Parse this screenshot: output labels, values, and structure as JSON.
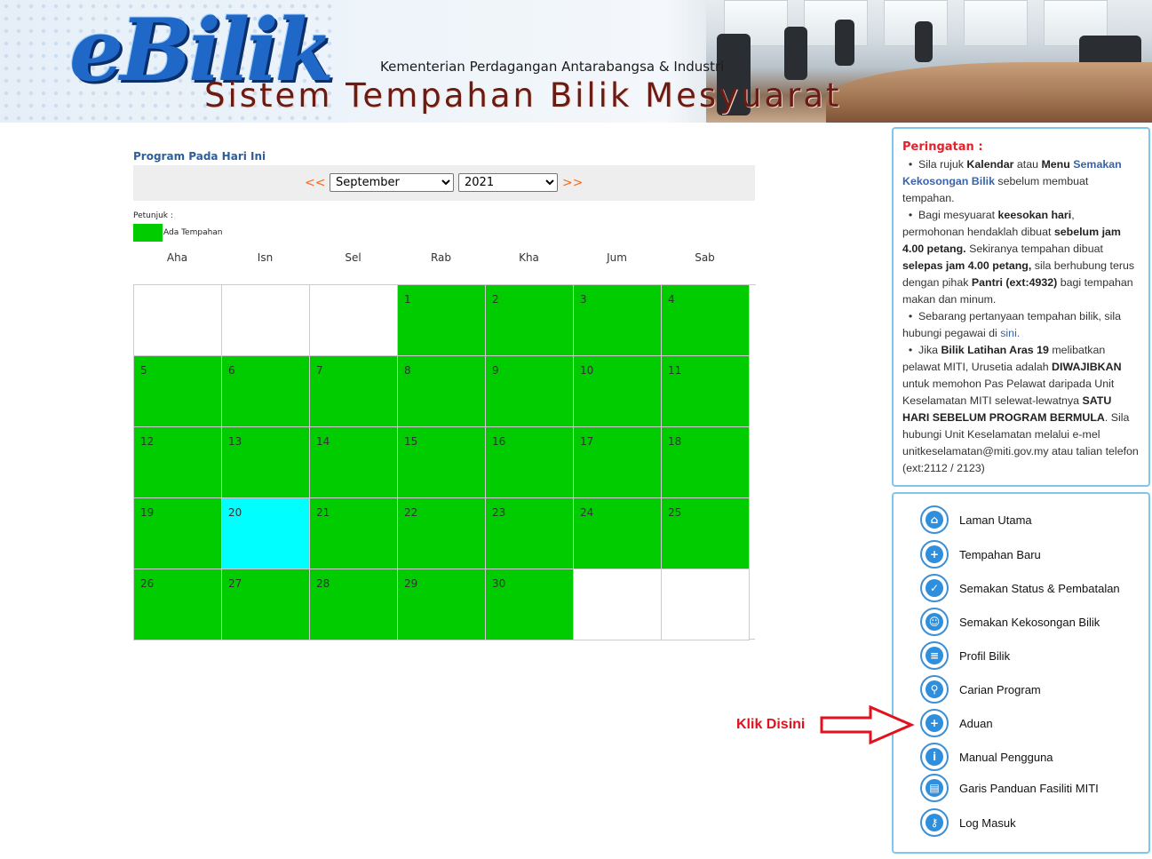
{
  "banner": {
    "logo": "eBilik",
    "ministry": "Kementerian Perdagangan Antarabangsa & Industri",
    "system": "Sistem Tempahan Bilik Mesyuarat"
  },
  "calendar": {
    "title": "Program Pada Hari Ini",
    "prev": "<<",
    "next": ">>",
    "month_selected": "September",
    "year_selected": "2021",
    "legend_title": "Petunjuk :",
    "legend_label": "Ada Tempahan",
    "booked_color": "#00cc00",
    "today_color": "#00ffff",
    "days": [
      "Aha",
      "Isn",
      "Sel",
      "Rab",
      "Kha",
      "Jum",
      "Sab"
    ],
    "weeks": [
      [
        {
          "d": "",
          "s": "empty"
        },
        {
          "d": "",
          "s": "empty"
        },
        {
          "d": "",
          "s": "empty"
        },
        {
          "d": "1",
          "s": "booked"
        },
        {
          "d": "2",
          "s": "booked"
        },
        {
          "d": "3",
          "s": "booked"
        },
        {
          "d": "4",
          "s": "booked"
        }
      ],
      [
        {
          "d": "5",
          "s": "booked"
        },
        {
          "d": "6",
          "s": "booked"
        },
        {
          "d": "7",
          "s": "booked"
        },
        {
          "d": "8",
          "s": "booked"
        },
        {
          "d": "9",
          "s": "booked"
        },
        {
          "d": "10",
          "s": "booked"
        },
        {
          "d": "11",
          "s": "booked"
        }
      ],
      [
        {
          "d": "12",
          "s": "booked"
        },
        {
          "d": "13",
          "s": "booked"
        },
        {
          "d": "14",
          "s": "booked"
        },
        {
          "d": "15",
          "s": "booked"
        },
        {
          "d": "16",
          "s": "booked"
        },
        {
          "d": "17",
          "s": "booked"
        },
        {
          "d": "18",
          "s": "booked"
        }
      ],
      [
        {
          "d": "19",
          "s": "booked"
        },
        {
          "d": "20",
          "s": "today"
        },
        {
          "d": "21",
          "s": "booked"
        },
        {
          "d": "22",
          "s": "booked"
        },
        {
          "d": "23",
          "s": "booked"
        },
        {
          "d": "24",
          "s": "booked"
        },
        {
          "d": "25",
          "s": "booked"
        }
      ],
      [
        {
          "d": "26",
          "s": "booked"
        },
        {
          "d": "27",
          "s": "booked"
        },
        {
          "d": "28",
          "s": "booked"
        },
        {
          "d": "29",
          "s": "booked"
        },
        {
          "d": "30",
          "s": "booked"
        },
        {
          "d": "",
          "s": "empty"
        },
        {
          "d": "",
          "s": "empty"
        }
      ]
    ]
  },
  "warning": {
    "title": "Peringatan :",
    "i1": {
      "a": "Sila rujuk ",
      "b": "Kalendar",
      "c": " atau ",
      "d": "Menu",
      "e": "Semakan Kekosongan Bilik",
      "f": " sebelum membuat tempahan."
    },
    "i2": {
      "a": "Bagi mesyuarat ",
      "b": "keesokan hari",
      "c": ", permohonan hendaklah dibuat ",
      "d": "sebelum jam 4.00 petang.",
      "e": " Sekiranya tempahan dibuat ",
      "f": "selepas jam 4.00 petang,",
      "g": " sila berhubung terus dengan pihak ",
      "h": "Pantri (ext:4932)",
      "i": " bagi tempahan makan dan minum."
    },
    "i3": {
      "a": "Sebarang pertanyaan tempahan bilik, sila hubungi pegawai di ",
      "b": "sini."
    },
    "i4": {
      "a": "Jika ",
      "b": "Bilik Latihan Aras 19",
      "c": " melibatkan pelawat MITI, Urusetia adalah ",
      "d": "DIWAJIBKAN",
      "e": " untuk memohon Pas Pelawat daripada Unit Keselamatan MITI selewat-lewatnya ",
      "f": "SATU HARI SEBELUM PROGRAM BERMULA",
      "g": ". Sila hubungi Unit Keselamatan melalui e-mel unitkeselamatan@miti.gov.my atau talian telefon (ext:2112 / 2123)"
    }
  },
  "menu": [
    {
      "label": "Laman Utama",
      "icon": "home-icon",
      "glyph": "⌂"
    },
    {
      "label": "Tempahan Baru",
      "icon": "new-booking-icon",
      "glyph": "+"
    },
    {
      "label": "Semakan Status & Pembatalan",
      "icon": "checklist-icon",
      "glyph": "✓"
    },
    {
      "label": "Semakan Kekosongan Bilik",
      "icon": "people-icon",
      "glyph": "☺"
    },
    {
      "label": "Profil Bilik",
      "icon": "document-icon",
      "glyph": "≡"
    },
    {
      "label": "Carian Program",
      "icon": "search-icon",
      "glyph": "⚲"
    },
    {
      "label": "Aduan",
      "icon": "complaint-icon",
      "glyph": "+"
    },
    {
      "label": "Manual Pengguna",
      "icon": "info-icon",
      "glyph": "i"
    },
    {
      "label": "Garis Panduan Fasiliti MITI",
      "icon": "clipboard-icon",
      "glyph": "▤"
    },
    {
      "label": "Log Masuk",
      "icon": "key-icon",
      "glyph": "⚷"
    }
  ],
  "callout": {
    "label": "Klik Disini",
    "color": "#e3101e"
  }
}
